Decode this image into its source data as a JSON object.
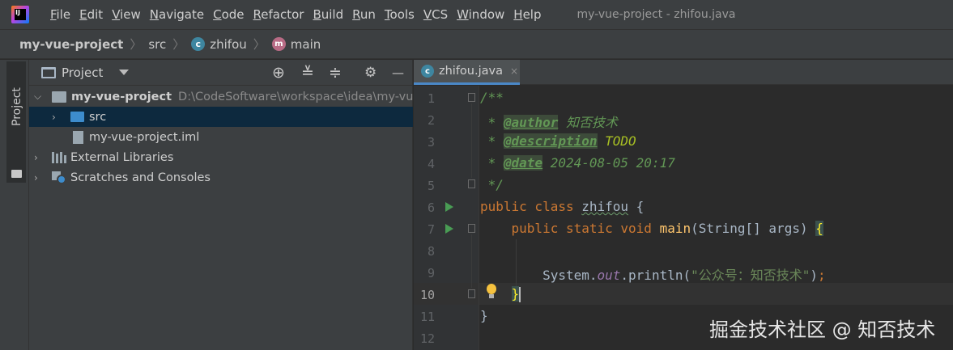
{
  "window": {
    "title": "my-vue-project - zhifou.java",
    "logo_text": "IJ"
  },
  "menu": {
    "items": [
      {
        "key": "F",
        "rest": "ile"
      },
      {
        "key": "E",
        "rest": "dit"
      },
      {
        "key": "V",
        "rest": "iew"
      },
      {
        "key": "N",
        "rest": "avigate"
      },
      {
        "key": "C",
        "rest": "ode"
      },
      {
        "key": "R",
        "rest": "efactor"
      },
      {
        "key": "B",
        "rest": "uild"
      },
      {
        "key": "R",
        "rest": "un"
      },
      {
        "key": "T",
        "rest": "ools"
      },
      {
        "key": "V",
        "rest": "CS"
      },
      {
        "key": "W",
        "rest": "indow"
      },
      {
        "key": "H",
        "rest": "elp"
      }
    ]
  },
  "breadcrumb": {
    "project": "my-vue-project",
    "folder": "src",
    "class_name": "zhifou",
    "class_badge": "c",
    "method_name": "main",
    "method_badge": "m"
  },
  "side_strip": {
    "tab_label": "Project"
  },
  "project_panel": {
    "title": "Project",
    "header_icons": [
      "crosshair-icon",
      "expand-all-icon",
      "collapse-all-icon",
      "gear-icon",
      "minimize-icon"
    ],
    "header_glyphs": {
      "crosshair": "⊕",
      "expand": "≚",
      "collapse": "≑",
      "gear": "⚙",
      "minimize": "—"
    },
    "tree": [
      {
        "label": "my-vue-project",
        "path": "D:\\CodeSoftware\\workspace\\idea\\my-vue-pro",
        "expanded": true,
        "bold": true
      },
      {
        "label": "src",
        "expanded": false,
        "selected": true
      },
      {
        "label": "my-vue-project.iml"
      },
      {
        "label": "External Libraries",
        "expanded": false
      },
      {
        "label": "Scratches and Consoles",
        "expanded": false
      }
    ]
  },
  "editor": {
    "tab": {
      "label": "zhifou.java",
      "badge": "c",
      "close": "×"
    },
    "current_line": 10,
    "line_numbers": [
      "1",
      "2",
      "3",
      "4",
      "5",
      "6",
      "7",
      "8",
      "9",
      "10",
      "11",
      "12"
    ],
    "code": {
      "l1": "/**",
      "l2_prefix": " * ",
      "l2_tag": "@author",
      "l2_text": " 知否技术",
      "l3_prefix": " * ",
      "l3_tag": "@description",
      "l3_text": " TODO",
      "l4_prefix": " * ",
      "l4_tag": "@date",
      "l4_text": " 2024-08-05 20:17",
      "l5": " */",
      "l6_kw": "public class ",
      "l6_cls": "zhifou",
      "l6_rest": " {",
      "l7_indent": "    ",
      "l7_kw": "public static void ",
      "l7_fn": "main",
      "l7_rest": "(String[] args) ",
      "l7_brace": "{",
      "l9_indent": "        ",
      "l9_obj": "System.",
      "l9_field": "out",
      "l9_call": ".println(",
      "l9_str": "\"公众号：知否技术\"",
      "l9_end": ")",
      "l9_semi": ";",
      "l10_indent": "    ",
      "l10_brace": "}",
      "l11": "}"
    }
  },
  "watermark": "掘金技术社区 @ 知否技术",
  "colors": {
    "keyword": "#cc7832",
    "comment": "#629755",
    "string": "#6a8759",
    "function": "#ffc66d",
    "field": "#9876aa",
    "todo": "#a8c023",
    "selection": "#0d293e"
  }
}
